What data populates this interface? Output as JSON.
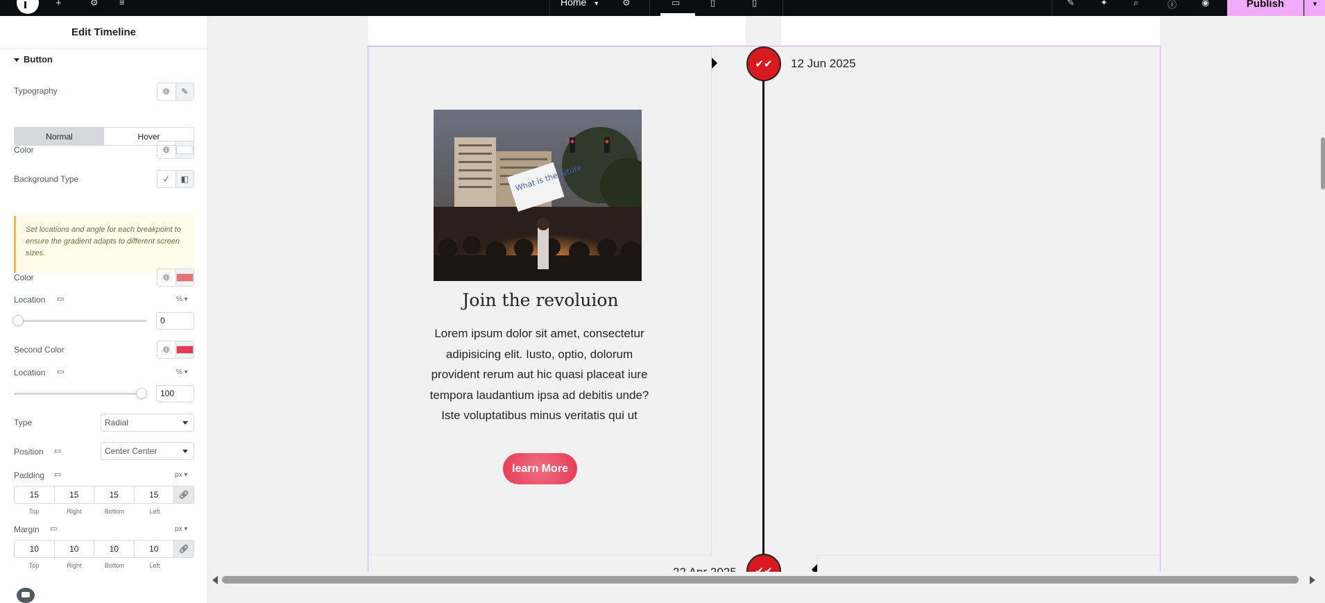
{
  "topbar": {
    "home_label": "Home",
    "publish_label": "Publish"
  },
  "panel": {
    "title": "Edit Timeline",
    "section": "Button",
    "typography_label": "Typography",
    "tabs": {
      "normal": "Normal",
      "hover": "Hover"
    },
    "color_label": "Color",
    "background_type_label": "Background Type",
    "notice": "Set locations and angle for each breakpoint to ensure the gradient adapts to different screen sizes.",
    "gradient_color_label": "Color",
    "gradient_color_hex": "#e57373",
    "location1_label": "Location",
    "location1_unit": "%",
    "location1_value": "0",
    "location1_level": 0,
    "second_color_label": "Second Color",
    "second_color_hex": "#e93a55",
    "location2_label": "Location",
    "location2_unit": "%",
    "location2_value": "100",
    "location2_level": 100,
    "type_label": "Type",
    "type_value": "Radial",
    "position_label": "Position",
    "position_value": "Center Center",
    "padding_label": "Padding",
    "padding_unit": "px",
    "padding": {
      "top": "15",
      "right": "15",
      "bottom": "15",
      "left": "15"
    },
    "margin_label": "Margin",
    "margin_unit": "px",
    "margin": {
      "top": "10",
      "right": "10",
      "bottom": "10",
      "left": "10"
    },
    "dim_labels": {
      "top": "Top",
      "right": "Right",
      "bottom": "Bottom",
      "left": "Left"
    }
  },
  "canvas": {
    "event1_date": "12 Jun 2025",
    "event2_date": "22 Apr 2025",
    "card_title": "Join the revoluion",
    "card_body": "Lorem ipsum dolor sit amet, consectetur adipisicing elit. Iusto, optio, dolorum provident rerum aut hic quasi placeat iure tempora laudantium ipsa ad debitis unde? Iste voluptatibus minus veritatis qui ut",
    "button_label": "learn More",
    "photo_sign_text": "What is the future"
  },
  "colors": {
    "accent": "#f0abfc",
    "marker": "#d71920",
    "button": "#e93a55"
  }
}
